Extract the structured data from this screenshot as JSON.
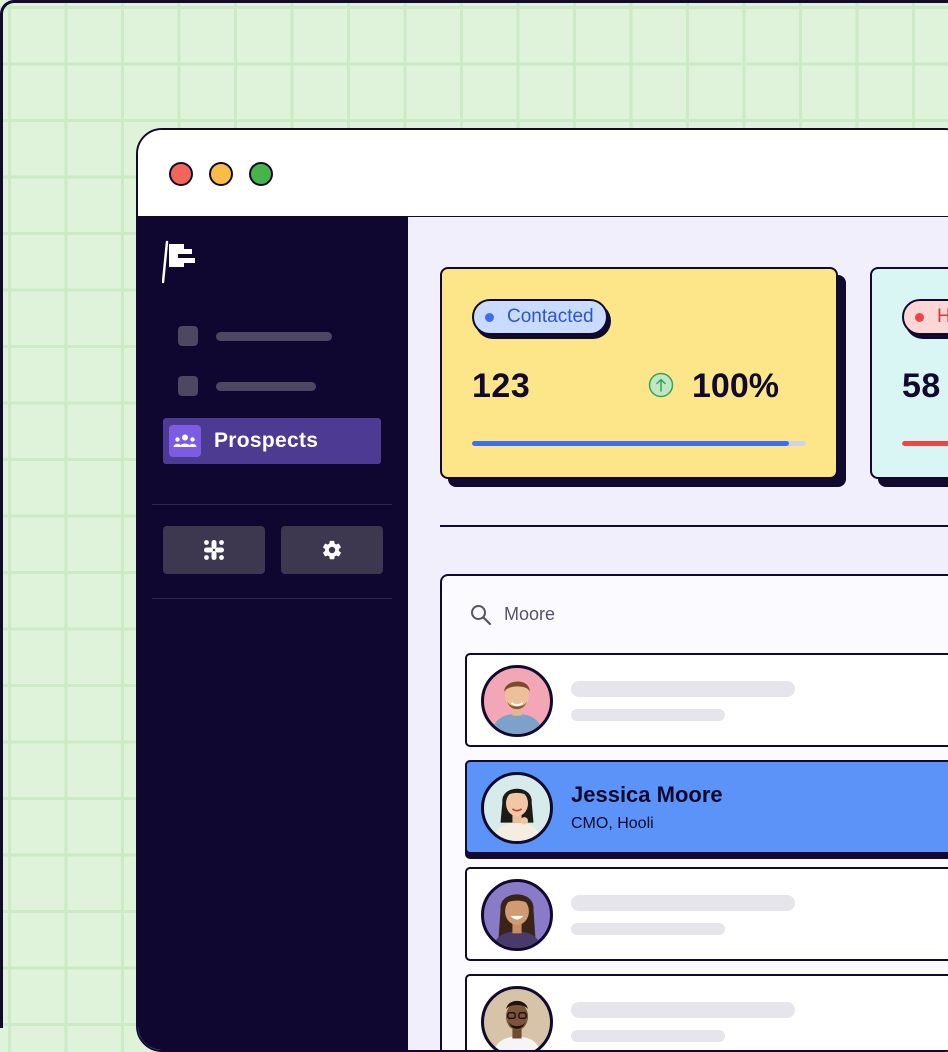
{
  "sidebar": {
    "active_item": {
      "label": "Prospects",
      "icon": "people-group-icon"
    },
    "buttons": [
      {
        "icon": "slack-icon"
      },
      {
        "icon": "gear-icon"
      }
    ]
  },
  "stats": [
    {
      "pill_label": "Contacted",
      "value": "123",
      "change": "100%",
      "progress": 0.95,
      "accent": "#3b6ef2",
      "card_color": "#fde68a"
    },
    {
      "pill_label": "H",
      "value": "58",
      "progress": 0.5,
      "accent": "#ef4444",
      "card_color": "#d9f6f5"
    }
  ],
  "search": {
    "value": "Moore"
  },
  "contacts": [
    {
      "selected": false
    },
    {
      "selected": true,
      "name": "Jessica Moore",
      "subtitle": "CMO, Hooli"
    },
    {
      "selected": false
    },
    {
      "selected": false
    }
  ],
  "colors": {
    "sidebar": "#0f0730",
    "active_nav": "#4d3a92",
    "selected_row": "#5b93f8",
    "background_grid": "#dff3da"
  }
}
